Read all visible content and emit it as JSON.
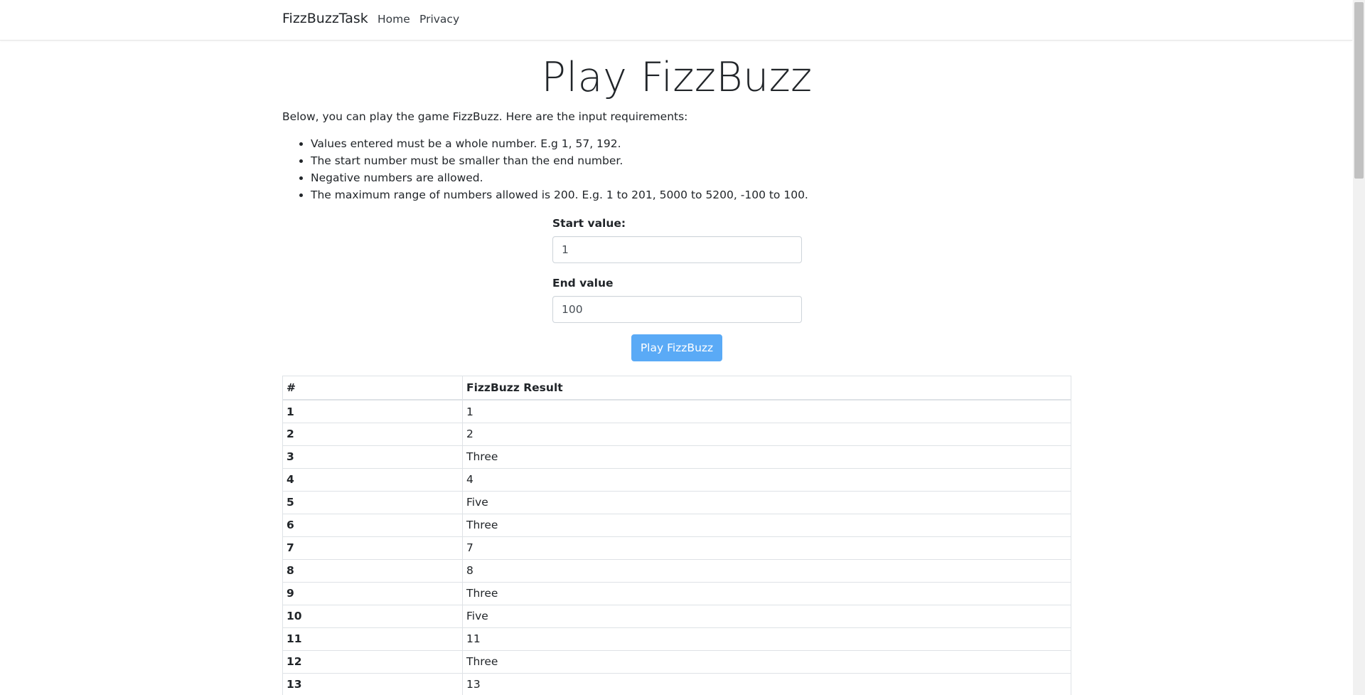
{
  "navbar": {
    "brand": "FizzBuzzTask",
    "links": [
      "Home",
      "Privacy"
    ]
  },
  "main": {
    "title": "Play FizzBuzz",
    "intro": "Below, you can play the game FizzBuzz. Here are the input requirements:",
    "requirements": [
      "Values entered must be a whole number. E.g 1, 57, 192.",
      "The start number must be smaller than the end number.",
      "Negative numbers are allowed.",
      "The maximum range of numbers allowed is 200. E.g. 1 to 201, 5000 to 5200, -100 to 100."
    ]
  },
  "form": {
    "start_label": "Start value:",
    "start_value": "1",
    "end_label": "End value",
    "end_value": "100",
    "button_label": "Play FizzBuzz",
    "button_color": "#5aaaf6"
  },
  "results": {
    "headers": [
      "#",
      "FizzBuzz Result"
    ],
    "rows": [
      [
        "1",
        "1"
      ],
      [
        "2",
        "2"
      ],
      [
        "3",
        "Three"
      ],
      [
        "4",
        "4"
      ],
      [
        "5",
        "Five"
      ],
      [
        "6",
        "Three"
      ],
      [
        "7",
        "7"
      ],
      [
        "8",
        "8"
      ],
      [
        "9",
        "Three"
      ],
      [
        "10",
        "Five"
      ],
      [
        "11",
        "11"
      ],
      [
        "12",
        "Three"
      ],
      [
        "13",
        "13"
      ]
    ]
  }
}
